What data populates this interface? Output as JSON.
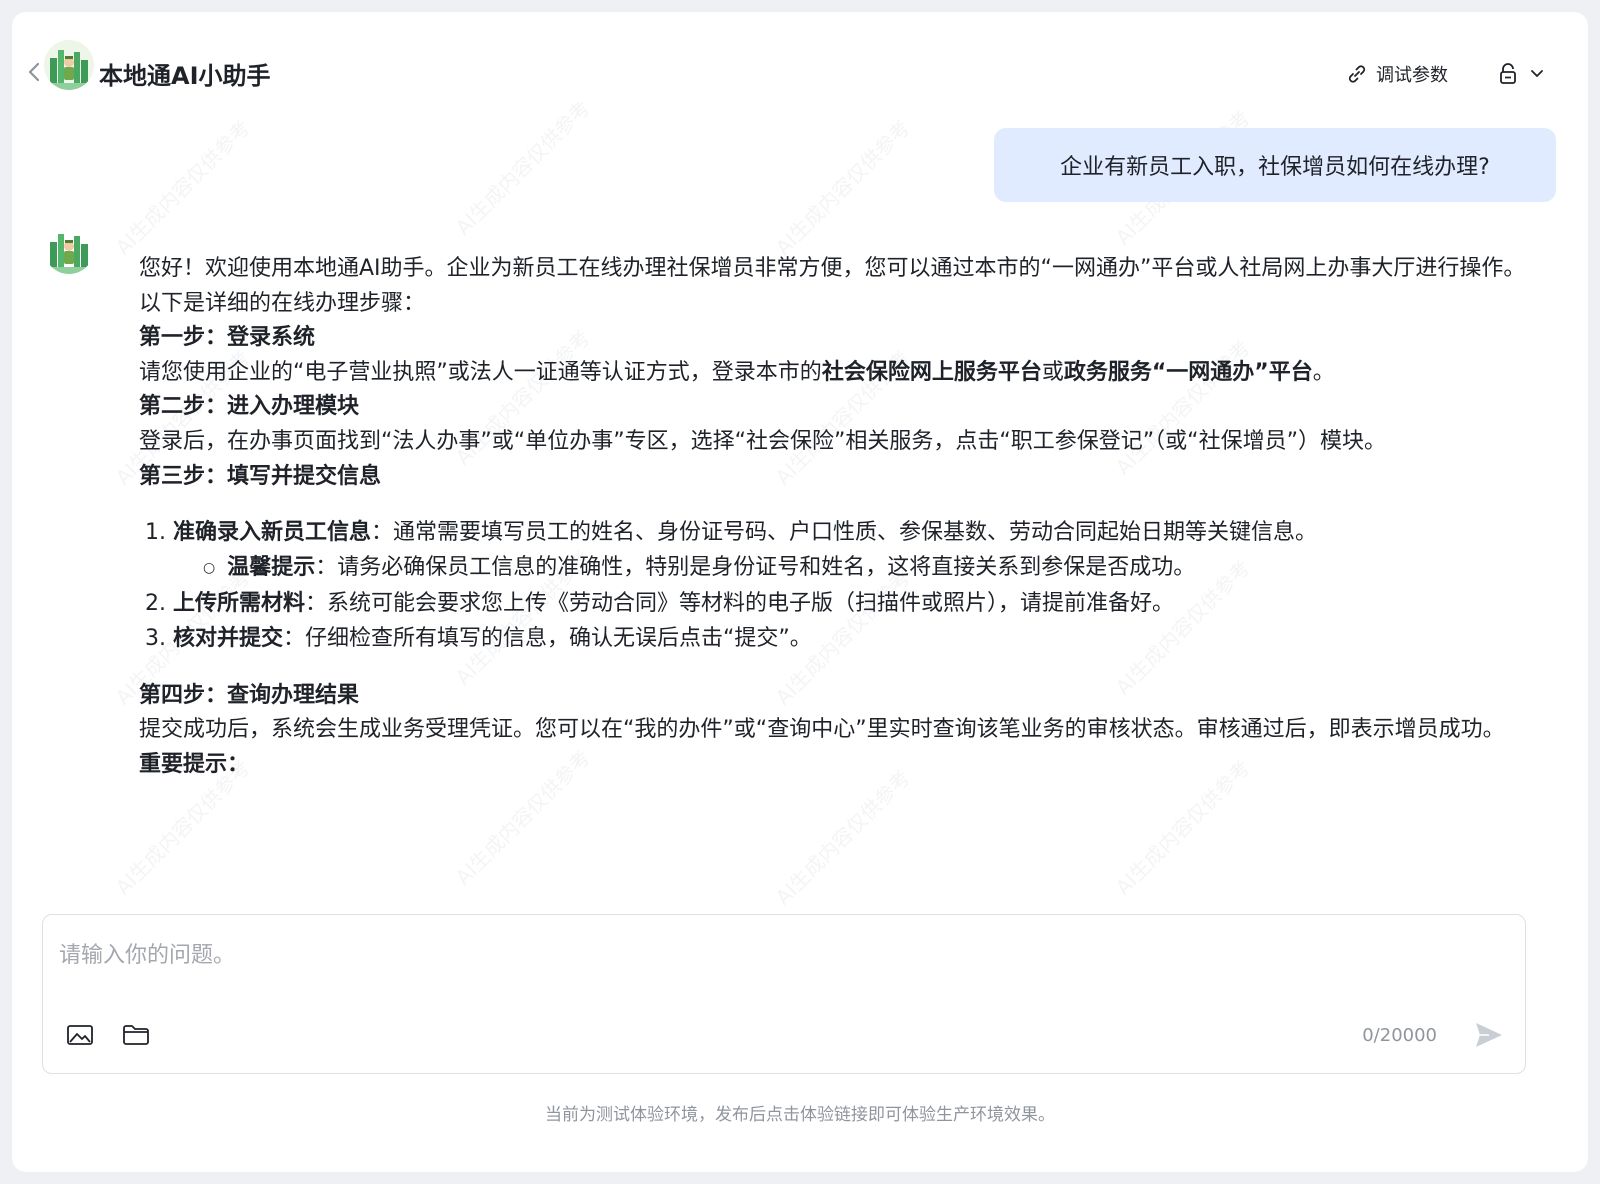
{
  "header": {
    "title": "本地通AI小助手",
    "debug_label": "调试参数"
  },
  "conversation": {
    "user_message": "企业有新员工入职，社保增员如何在线办理?",
    "bot": {
      "intro": "您好！欢迎使用本地通AI助手。企业为新员工在线办理社保增员非常方便，您可以通过本市的“一网通办”平台或人社局网上办事大厅进行操作。",
      "lead": "以下是详细的在线办理步骤：",
      "step1_title": "第一步：登录系统",
      "step1_text_a": "请您使用企业的“电子营业执照”或法人一证通等认证方式，登录本市的",
      "step1_bold_a": "社会保险网上服务平台",
      "step1_text_b": "或",
      "step1_bold_b": "政务服务“一网通办”平台",
      "step1_text_c": "。",
      "step2_title": "第二步：进入办理模块",
      "step2_text": "登录后，在办事页面找到“法人办事”或“单位办事”专区，选择“社会保险”相关服务，点击“职工参保登记”（或“社保增员”）模块。",
      "step3_title": "第三步：填写并提交信息",
      "items": [
        {
          "bold": "准确录入新员工信息",
          "text": "：通常需要填写员工的姓名、身份证号码、户口性质、参保基数、劳动合同起始日期等关键信息。"
        },
        {
          "bold": "上传所需材料",
          "text": "：系统可能会要求您上传《劳动合同》等材料的电子版（扫描件或照片），请提前准备好。"
        },
        {
          "bold": "核对并提交",
          "text": "：仔细检查所有填写的信息，确认无误后点击“提交”。"
        }
      ],
      "tip": {
        "bold": "温馨提示",
        "text": "：请务必确保员工信息的准确性，特别是身份证号和姓名，这将直接关系到参保是否成功。"
      },
      "step4_title": "第四步：查询办理结果",
      "step4_text": "提交成功后，系统会生成业务受理凭证。您可以在“我的办件”或“查询中心”里实时查询该笔业务的审核状态。审核通过后，即表示增员成功。",
      "important_title": "重要提示："
    }
  },
  "watermark": "AI生成内容仅供参考",
  "input": {
    "placeholder": "请输入你的问题。",
    "counter": "0/20000"
  },
  "footer_note": "当前为测试体验环境，发布后点击体验链接即可体验生产环境效果。",
  "icons": {
    "back": "chevron-left-icon",
    "debug": "link-icon",
    "lock": "lock-icon",
    "dropdown": "chevron-down-icon",
    "image": "image-icon",
    "folder": "folder-icon",
    "send": "send-icon"
  },
  "colors": {
    "user_bubble": "#e1ebff",
    "page_bg": "#eef0f3",
    "muted_text": "#8f959e"
  }
}
